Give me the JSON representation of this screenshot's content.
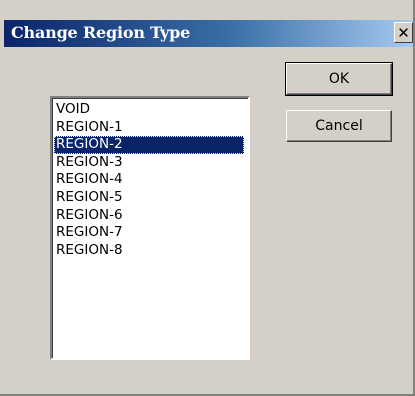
{
  "dialog": {
    "title": "Change Region Type",
    "close_glyph": "✕",
    "close_icon": "close-icon"
  },
  "buttons": {
    "ok_label": "OK",
    "cancel_label": "Cancel"
  },
  "region_list": {
    "items": [
      "VOID",
      "REGION-1",
      "REGION-2",
      "REGION-3",
      "REGION-4",
      "REGION-5",
      "REGION-6",
      "REGION-7",
      "REGION-8"
    ],
    "selected_index": 2
  },
  "colors": {
    "title_bar_start": "#0a246a",
    "title_bar_end": "#a6caf0",
    "selection": "#0a246a",
    "dialog_face": "#d4d0c8"
  }
}
